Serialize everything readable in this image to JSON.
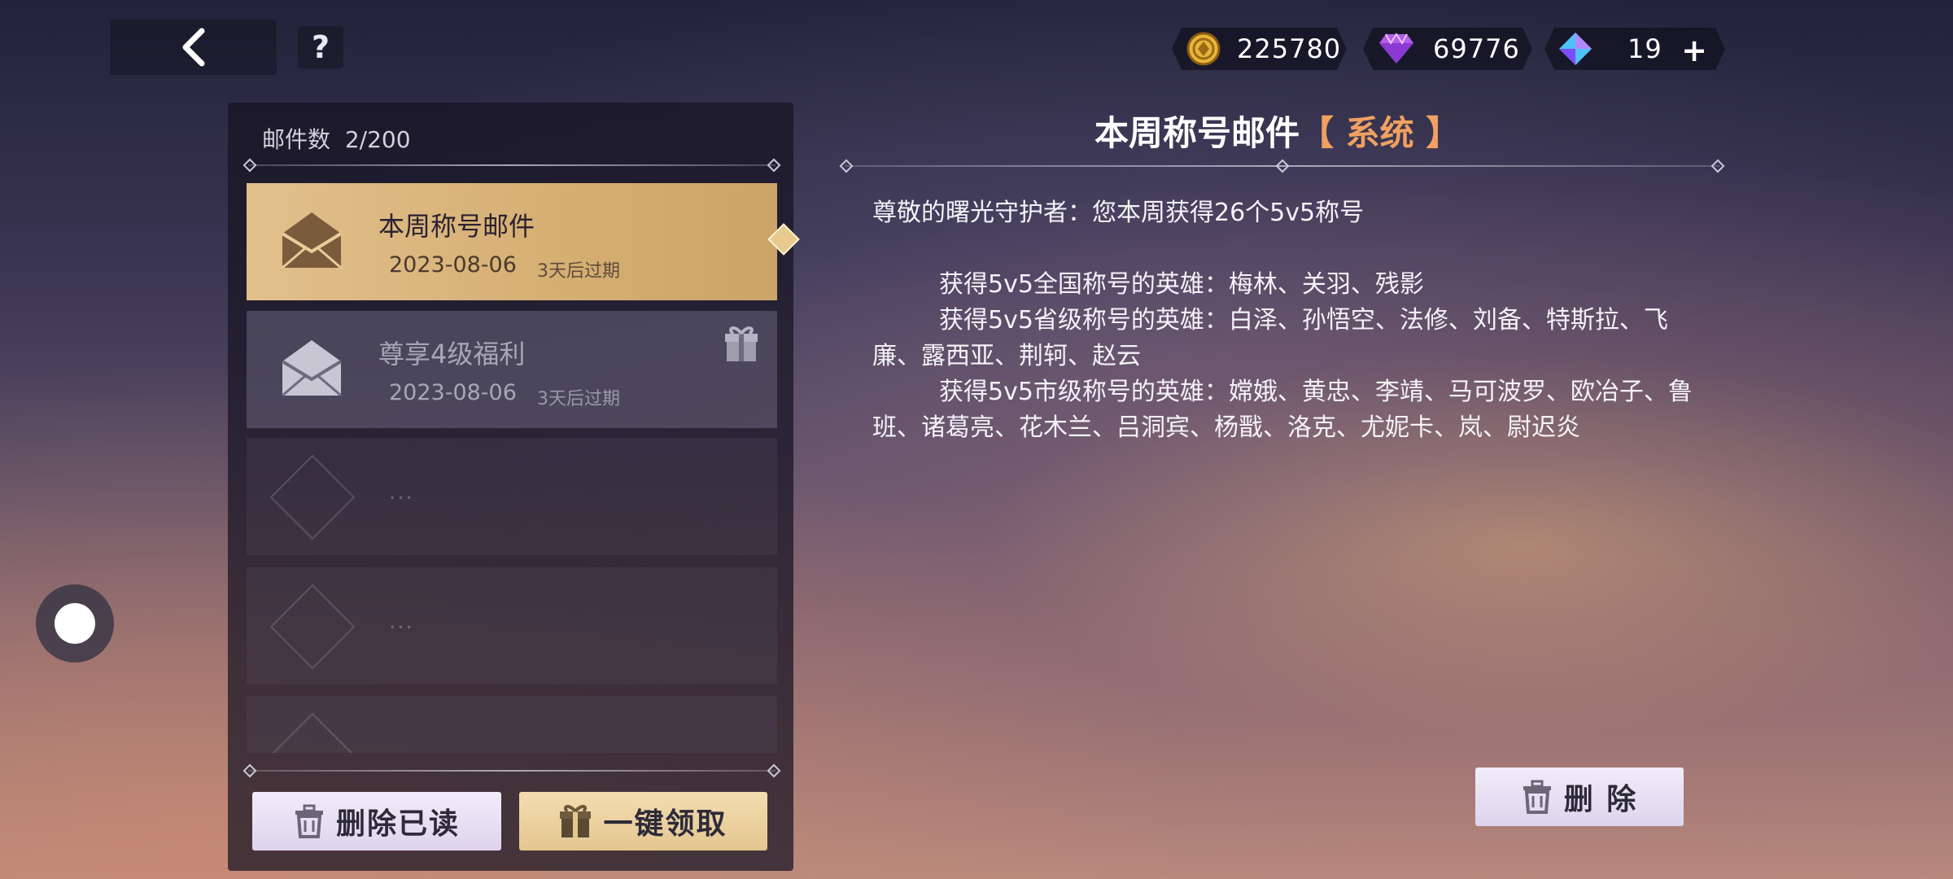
{
  "header": {
    "help_label": "?",
    "currencies": [
      {
        "name": "gold-coin",
        "value": "225780"
      },
      {
        "name": "purple-gem",
        "value": "69776"
      },
      {
        "name": "diamond",
        "value": "19"
      }
    ],
    "add_label": "+"
  },
  "mail_list": {
    "count_label": "邮件数",
    "count_value": "2/200",
    "items": [
      {
        "title": "本周称号邮件",
        "date": "2023-08-06",
        "expire": "3天后过期",
        "selected": true
      },
      {
        "title": "尊享4级福利",
        "date": "2023-08-06",
        "expire": "3天后过期",
        "selected": false,
        "has_gift": true
      }
    ],
    "placeholder": "..."
  },
  "buttons": {
    "delete_read": "删除已读",
    "claim_all": "一键领取",
    "delete": "删 除"
  },
  "detail": {
    "title": "本周称号邮件",
    "tag": "【 系统 】",
    "greeting": "尊敬的曙光守护者：您本周获得26个5v5称号",
    "line_national": "获得5v5全国称号的英雄：梅林、关羽、残影",
    "line_provincial": "获得5v5省级称号的英雄：白泽、孙悟空、法修、刘备、特斯拉、飞廉、露西亚、荆轲、赵云",
    "line_city": "获得5v5市级称号的英雄：嫦娥、黄忠、李靖、马可波罗、欧冶子、鲁班、诸葛亮、花木兰、吕洞宾、杨戬、洛克、尤妮卡、岚、尉迟炎"
  },
  "colors": {
    "selected_mail": "#d5ae72",
    "tag_orange": "#f0a060",
    "claim_button": "#e4c690"
  }
}
